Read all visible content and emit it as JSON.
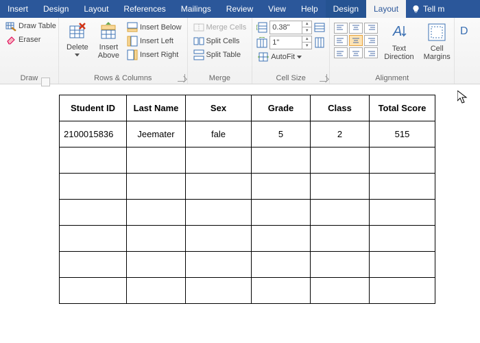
{
  "tabs": {
    "items": [
      "Insert",
      "Design",
      "Layout",
      "References",
      "Mailings",
      "Review",
      "View",
      "Help",
      "Design",
      "Layout"
    ],
    "tell_me": "Tell m"
  },
  "ribbon": {
    "draw": {
      "label": "Draw",
      "draw_table": "Draw Table",
      "eraser": "Eraser"
    },
    "rowscols": {
      "label": "Rows & Columns",
      "delete": "Delete",
      "insert_above": "Insert\nAbove",
      "below": "Insert Below",
      "left": "Insert Left",
      "right": "Insert Right"
    },
    "merge": {
      "label": "Merge",
      "merge_cells": "Merge Cells",
      "split_cells": "Split Cells",
      "split_table": "Split Table"
    },
    "cellsize": {
      "label": "Cell Size",
      "height": "0.38\"",
      "width": "1\"",
      "autofit": "AutoFit"
    },
    "alignment": {
      "label": "Alignment",
      "text_dir": "Text\nDirection",
      "cell_margins": "Cell\nMargins"
    }
  },
  "table": {
    "headers": [
      "Student ID",
      "Last Name",
      "Sex",
      "Grade",
      "Class",
      "Total Score"
    ],
    "row": [
      "2100015836",
      "Jeemater",
      "fale",
      "5",
      "2",
      "515"
    ]
  }
}
